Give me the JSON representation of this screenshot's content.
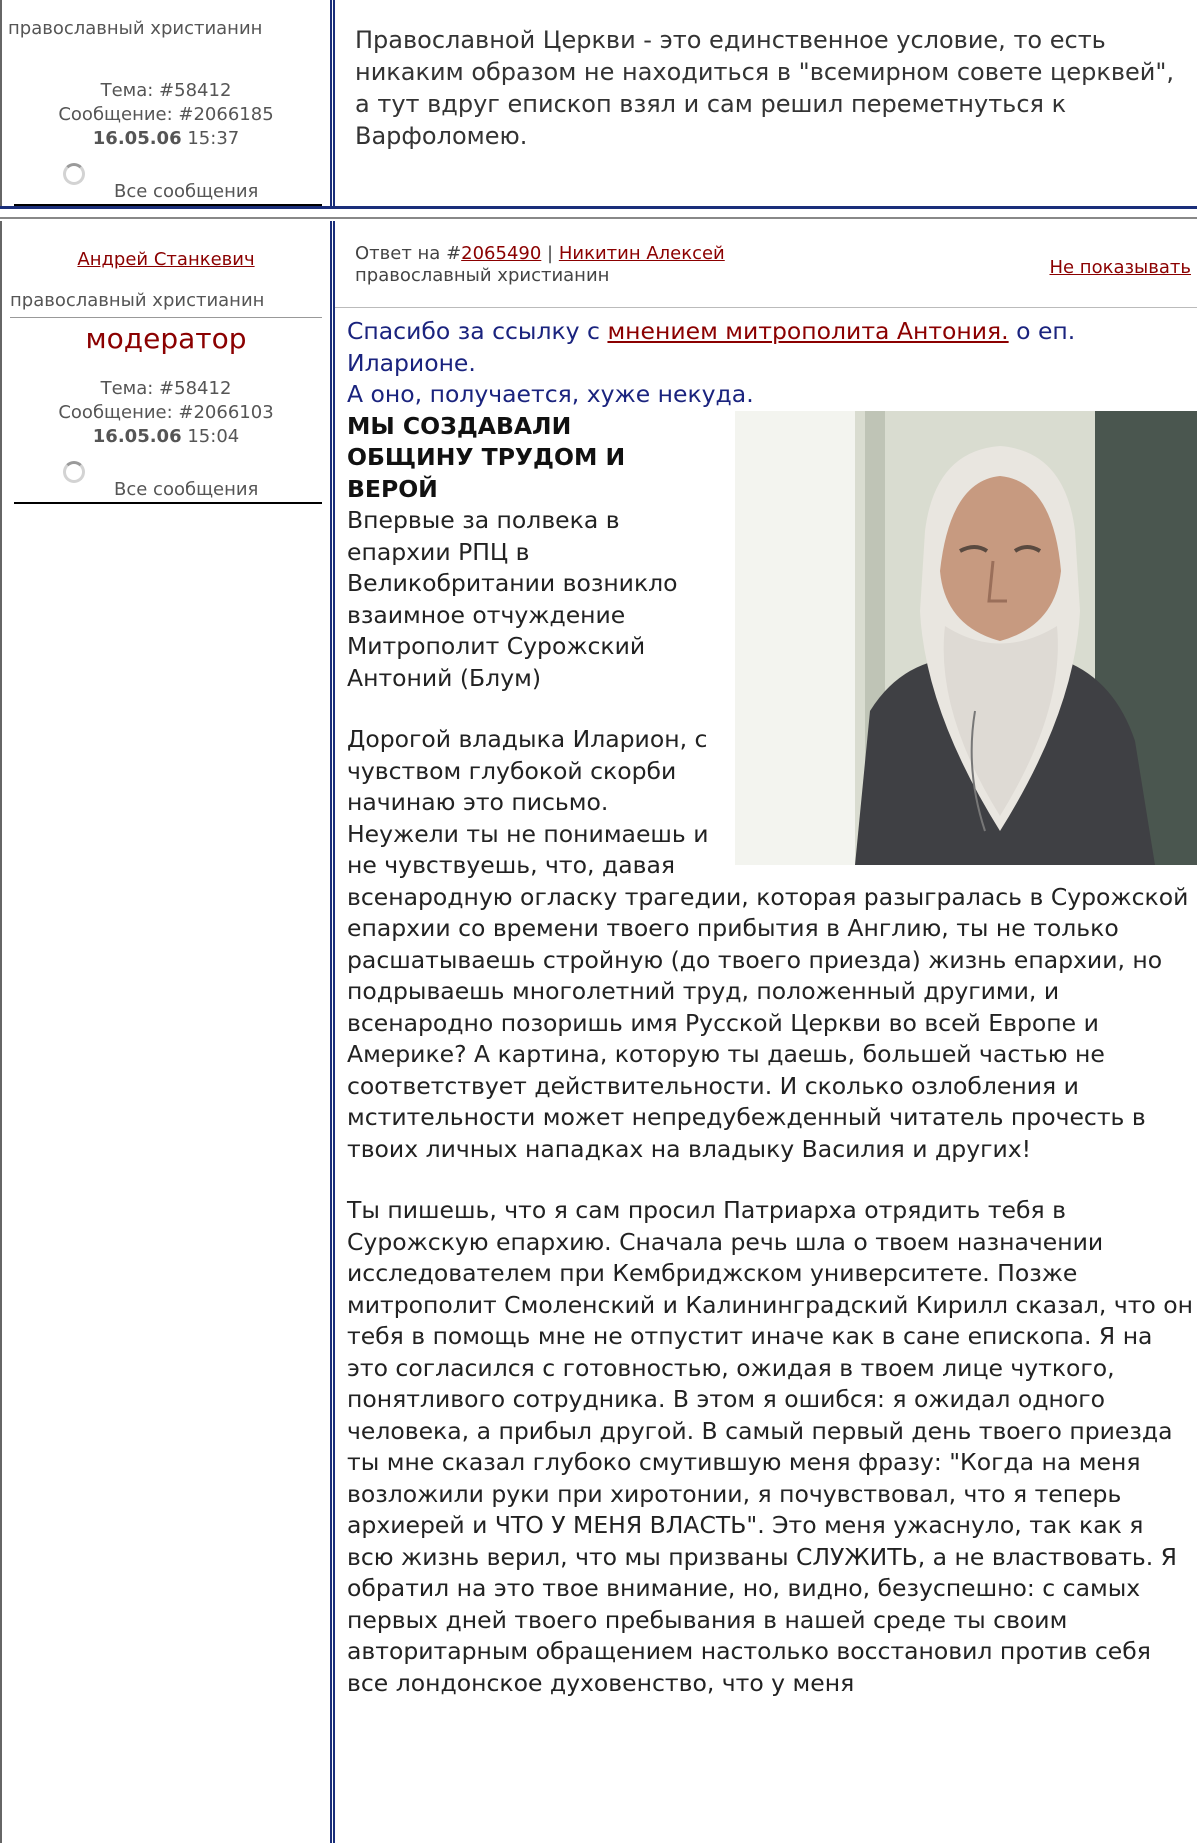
{
  "post1": {
    "rank": "православный христианин",
    "topic": "Тема: #58412",
    "message": "Сообщение: #2066185",
    "date": "16.05.06",
    "time": "15:37",
    "all_messages": "Все сообщения",
    "body": "Православной Церкви - это единственное условие, то есть никаким образом не находиться в \"всемирном совете церквей\", а тут вдруг епископ взял и сам решил переметнуться к Варфоломею."
  },
  "post2": {
    "author": "Андрей Станкевич",
    "rank": "православный христианин",
    "role": "модератор",
    "topic": "Тема: #58412",
    "message": "Сообщение: #2066103",
    "date": "16.05.06",
    "time": "15:04",
    "all_messages": "Все сообщения",
    "reply_prefix": "Ответ на #",
    "reply_id": "2065490",
    "reply_sep": " | ",
    "reply_author": "Никитин Алексей",
    "reply_rank": " православный христианин",
    "hide_label": "Не показывать",
    "intro_before": "Спасибо за ссылку с ",
    "intro_link": "мнением митрополита Антония.",
    "intro_after": " о еп. Иларионе.",
    "intro_line2": "А оно, получается, хуже некуда.",
    "heading": "МЫ СОЗДАВАЛИ ОБЩИНУ ТРУДОМ И ВЕРОЙ",
    "subtitle": "Впервые за полвека в епархии РПЦ в Великобритании возникло взаимное отчуждение",
    "byline": "Митрополит Сурожский Антоний (Блум)",
    "para1": "Дорогой владыка Иларион, с чувством глубокой скорби начинаю это письмо. Неужели ты не понимаешь и не чувствуешь, что, давая всенародную огласку трагедии, которая разыгралась в Сурожской епархии со времени твоего прибытия в Англию, ты не только расшатываешь стройную (до твоего приезда) жизнь епархии, но подрываешь многолетний труд, положенный другими, и всенародно позоришь имя Русской Церкви во всей Европе и Америке? А картина, которую ты даешь, большей частью не соответствует действительности. И сколько озлобления и мстительности может непредубежденный читатель прочесть в твоих личных нападках на владыку Василия и других!",
    "para2": "Ты пишешь, что я сам просил Патриарха отрядить тебя в Сурожскую епархию. Сначала речь шла о твоем назначении исследователем при Кембриджском университете. Позже митрополит Смоленский и Калининградский Кирилл сказал, что он тебя в помощь мне не отпустит иначе как в сане епископа. Я на это согласился с готовностью, ожидая в твоем лице чуткого, понятливого сотрудника. В этом я ошибся: я ожидал одного человека, а прибыл другой. В самый первый день твоего приезда ты мне сказал глубоко смутившую меня фразу: \"Когда на меня возложили руки при хиротонии, я почувствовал, что я теперь архиерей и ЧТО У МЕНЯ ВЛАСТЬ\". Это меня ужаснуло, так как я всю жизнь верил, что мы призваны СЛУЖИТЬ, а не властвовать. Я обратил на это твое внимание, но, видно, безуспешно: с самых первых дней твоего пребывания в нашей среде ты своим авторитарным обращением настолько восстановил против себя все лондонское духовенство, что у меня"
  }
}
